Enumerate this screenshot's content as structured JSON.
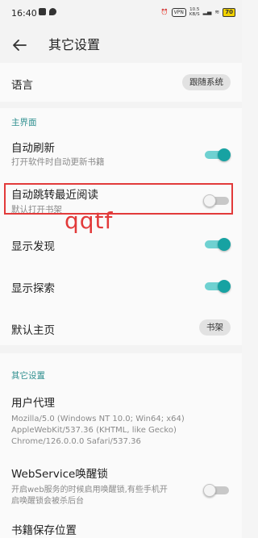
{
  "status": {
    "time": "16:40",
    "vpn": "VPN",
    "speed_value": "10.5",
    "speed_unit": "KB/S",
    "battery": "70"
  },
  "appbar": {
    "title": "其它设置"
  },
  "settings": {
    "language": {
      "title": "语言",
      "value": "跟随系统"
    },
    "main_section": "主界面",
    "auto_refresh": {
      "title": "自动刷新",
      "subtitle": "打开软件时自动更新书籍",
      "enabled": true
    },
    "auto_jump": {
      "title": "自动跳转最近阅读",
      "subtitle": "默认打开书架",
      "enabled": false
    },
    "show_discover": {
      "title": "显示发现",
      "enabled": true
    },
    "show_explore": {
      "title": "显示探索",
      "enabled": true
    },
    "default_home": {
      "title": "默认主页",
      "value": "书架"
    },
    "other_section": "其它设置",
    "user_agent": {
      "title": "用户代理",
      "line1": "Mozilla/5.0 (Windows NT 10.0; Win64; x64)",
      "line2": "AppleWebKit/537.36 (KHTML, like Gecko)",
      "line3": "Chrome/126.0.0.0 Safari/537.36"
    },
    "webservice_lock": {
      "title": "WebService唤醒锁",
      "subtitle1": "开启web服务的时候启用唤醒锁,有些手机开",
      "subtitle2": "启唤醒锁会被杀后台",
      "enabled": false
    },
    "book_save_location": {
      "title": "书籍保存位置"
    }
  },
  "annotation": {
    "watermark": "qqtf"
  },
  "colors": {
    "accent": "#17a2a2",
    "section": "#2e8f8f",
    "highlight": "#e23a3a"
  }
}
